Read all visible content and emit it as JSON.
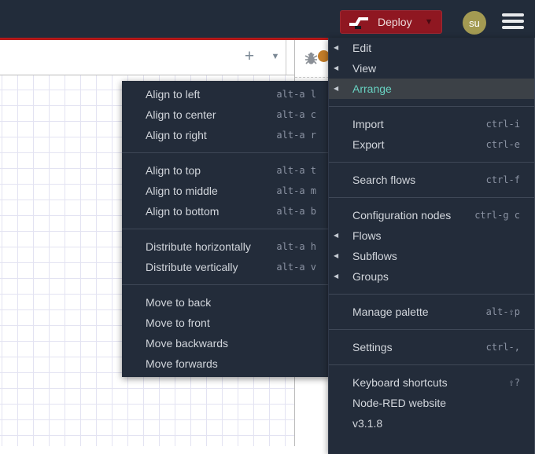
{
  "header": {
    "deploy": {
      "label": "Deploy"
    },
    "avatar": {
      "initials": "su"
    }
  },
  "workspace": {
    "tabbar": {
      "add_icon": "+",
      "list_caret_icon": "▼"
    }
  },
  "icons": {
    "submenu_left_arrow": "◀",
    "deploy_caret": "▼"
  },
  "main_menu": {
    "groups": [
      {
        "items": [
          {
            "label": "Edit",
            "submenu_arrow": true
          },
          {
            "label": "View",
            "submenu_arrow": true
          },
          {
            "label": "Arrange",
            "submenu_arrow": true,
            "active": true
          }
        ]
      },
      {
        "items": [
          {
            "label": "Import",
            "shortcut": "ctrl-i"
          },
          {
            "label": "Export",
            "shortcut": "ctrl-e"
          }
        ]
      },
      {
        "items": [
          {
            "label": "Search flows",
            "shortcut": "ctrl-f"
          }
        ]
      },
      {
        "items": [
          {
            "label": "Configuration nodes",
            "shortcut": "ctrl-g c"
          },
          {
            "label": "Flows",
            "submenu_arrow": true
          },
          {
            "label": "Subflows",
            "submenu_arrow": true
          },
          {
            "label": "Groups",
            "submenu_arrow": true
          }
        ]
      },
      {
        "items": [
          {
            "label": "Manage palette",
            "shortcut": "alt-⇧p"
          }
        ]
      },
      {
        "items": [
          {
            "label": "Settings",
            "shortcut": "ctrl-,"
          }
        ]
      },
      {
        "items": [
          {
            "label": "Keyboard shortcuts",
            "shortcut": "⇧?"
          },
          {
            "label": "Node-RED website"
          },
          {
            "label": "v3.1.8"
          }
        ]
      }
    ]
  },
  "arrange_submenu": {
    "groups": [
      {
        "items": [
          {
            "label": "Align to left",
            "shortcut": "alt-a l"
          },
          {
            "label": "Align to center",
            "shortcut": "alt-a c"
          },
          {
            "label": "Align to right",
            "shortcut": "alt-a r"
          }
        ]
      },
      {
        "items": [
          {
            "label": "Align to top",
            "shortcut": "alt-a t"
          },
          {
            "label": "Align to middle",
            "shortcut": "alt-a m"
          },
          {
            "label": "Align to bottom",
            "shortcut": "alt-a b"
          }
        ]
      },
      {
        "items": [
          {
            "label": "Distribute horizontally",
            "shortcut": "alt-a h"
          },
          {
            "label": "Distribute vertically",
            "shortcut": "alt-a v"
          }
        ]
      },
      {
        "items": [
          {
            "label": "Move to back"
          },
          {
            "label": "Move to front"
          },
          {
            "label": "Move backwards"
          },
          {
            "label": "Move forwards"
          }
        ]
      }
    ]
  },
  "colors": {
    "header-bg": "#222c3a",
    "accent-red": "#b51a1a",
    "deploy-red": "#8f1721",
    "avatar-olive": "#a39a52",
    "menu-bg": "#232c3a",
    "menu-sep": "#3f4857",
    "menu-fg": "#d2d6dc",
    "menu-shortcut-fg": "#8b93a3",
    "menu-active-bg": "#3c4147",
    "menu-active-fg": "#68d2c2",
    "grid-line": "#e3e3f2"
  }
}
